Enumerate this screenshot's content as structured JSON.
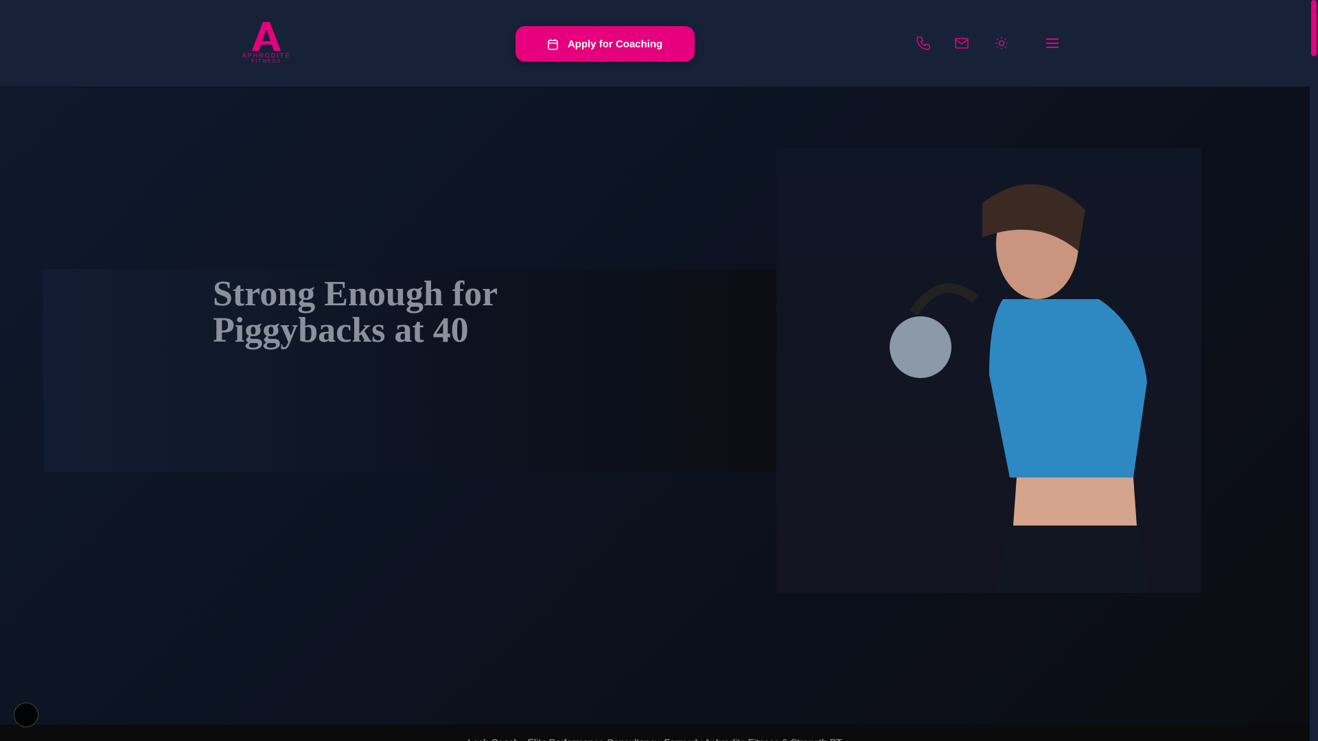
{
  "header": {
    "logo": {
      "line1": "APHRODITE",
      "line2": "FITNESS"
    },
    "cta_label": "Apply for Coaching",
    "icons": [
      "phone-icon",
      "mail-icon",
      "sun-icon",
      "menu-icon"
    ]
  },
  "hero": {
    "title_line1": "Strong Enough for",
    "title_line2": "Piggybacks at 40"
  },
  "footer": {
    "text": "Lech Coach - Elite Performance Consultancy. Formerly Aphrodite Fitness & Strength PT"
  },
  "colors": {
    "accent": "#e6007e",
    "header_bg": "#172239",
    "title": "#8b919c"
  }
}
